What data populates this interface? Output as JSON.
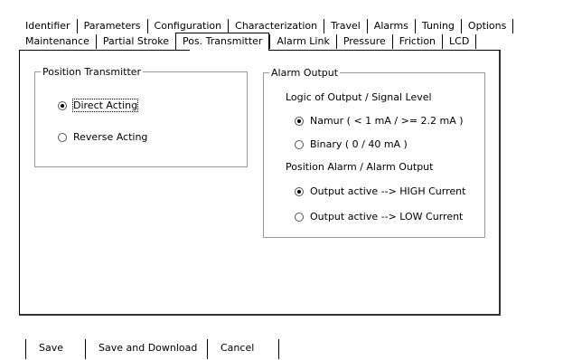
{
  "tabs_row1": [
    "Identifier",
    "Parameters",
    "Configuration",
    "Characterization",
    "Travel",
    "Alarms",
    "Tuning",
    "Options"
  ],
  "tabs_row2": [
    "Maintenance",
    "Partial Stroke",
    "Pos. Transmitter",
    "Alarm Link",
    "Pressure",
    "Friction",
    "LCD"
  ],
  "active_tab": "Pos. Transmitter",
  "position_transmitter": {
    "legend": "Position Transmitter",
    "options": [
      {
        "label": "Direct Acting",
        "selected": true
      },
      {
        "label": "Reverse Acting",
        "selected": false
      }
    ]
  },
  "alarm_output": {
    "legend": "Alarm Output",
    "signal_level_title": "Logic of Output / Signal Level",
    "signal_level_options": [
      {
        "label": "Namur ( < 1 mA / >= 2.2 mA )",
        "selected": true
      },
      {
        "label": "Binary ( 0 / 40 mA )",
        "selected": false
      }
    ],
    "position_alarm_title": "Position Alarm / Alarm Output",
    "position_alarm_options": [
      {
        "label": "Output active --> HIGH Current",
        "selected": true
      },
      {
        "label": "Output active --> LOW Current",
        "selected": false
      }
    ]
  },
  "buttons": {
    "save": "Save",
    "save_download": "Save and Download",
    "cancel": "Cancel"
  }
}
